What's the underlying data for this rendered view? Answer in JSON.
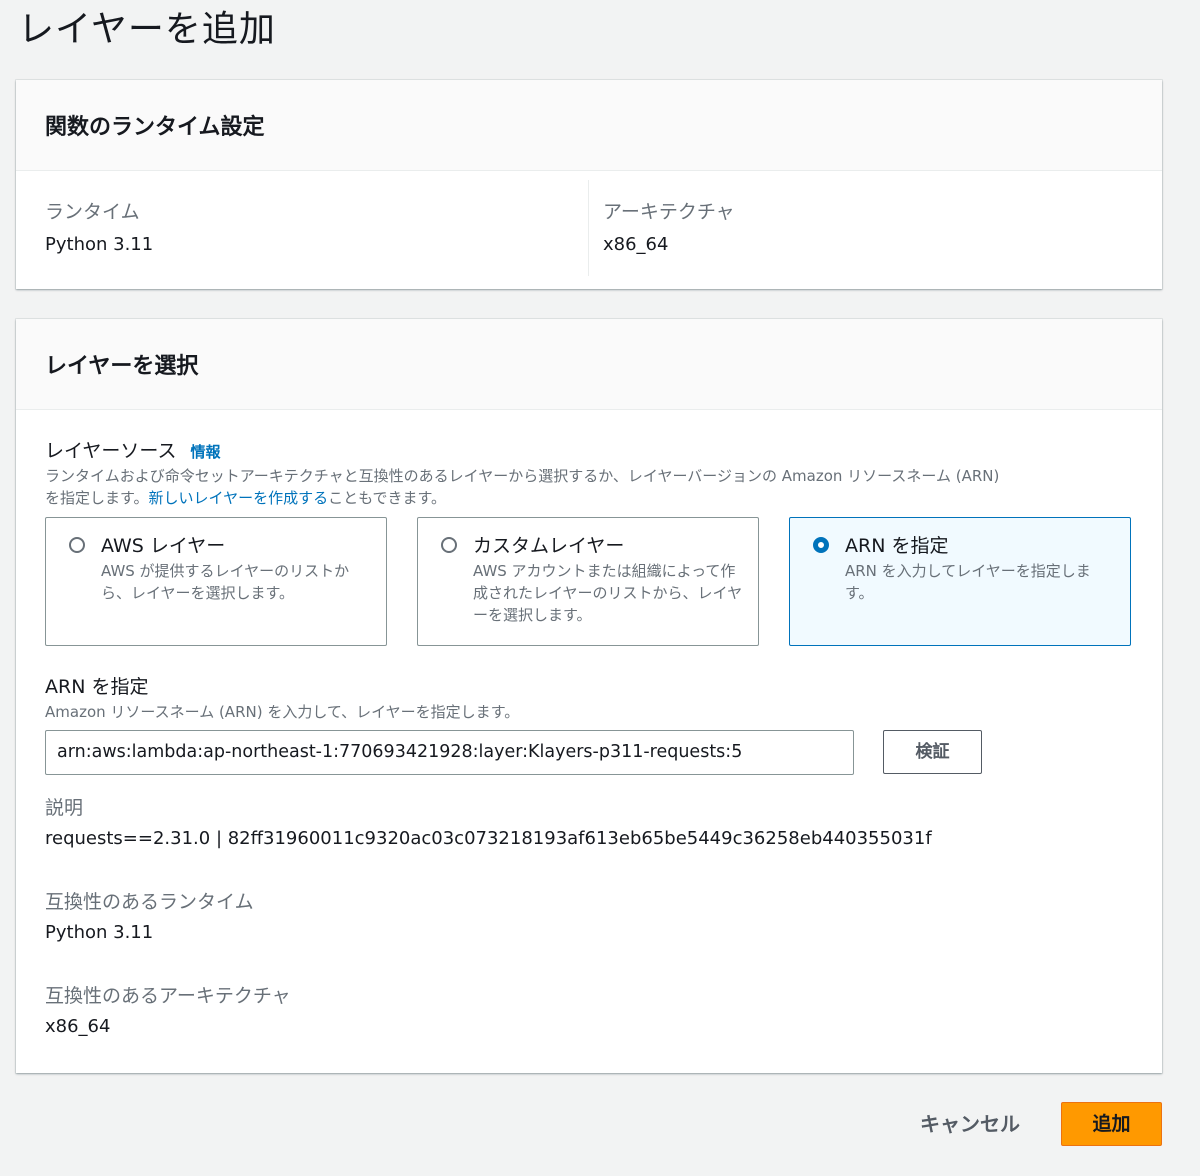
{
  "page": {
    "title": "レイヤーを追加"
  },
  "runtime_panel": {
    "heading": "関数のランタイム設定",
    "runtime_label": "ランタイム",
    "runtime_value": "Python 3.11",
    "arch_label": "アーキテクチャ",
    "arch_value": "x86_64"
  },
  "layer_panel": {
    "heading": "レイヤーを選択",
    "source_label": "レイヤーソース",
    "info_link": "情報",
    "source_desc_1": "ランタイムおよび命令セットアーキテクチャと互換性のあるレイヤーから選択するか、レイヤーバージョンの Amazon リソースネーム (ARN)",
    "source_desc_2_pre": "を指定します。",
    "source_desc_link": "新しいレイヤーを作成する",
    "source_desc_2_post": "こともできます。",
    "options": [
      {
        "title": "AWS レイヤー",
        "desc": "AWS が提供するレイヤーのリストから、レイヤーを選択します。",
        "selected": false
      },
      {
        "title": "カスタムレイヤー",
        "desc": "AWS アカウントまたは組織によって作成されたレイヤーのリストから、レイヤーを選択します。",
        "selected": false
      },
      {
        "title": "ARN を指定",
        "desc": "ARN を入力してレイヤーを指定します。",
        "selected": true
      }
    ],
    "arn_label": "ARN を指定",
    "arn_desc": "Amazon リソースネーム (ARN) を入力して、レイヤーを指定します。",
    "arn_value": "arn:aws:lambda:ap-northeast-1:770693421928:layer:Klayers-p311-requests:5",
    "verify_button": "検証",
    "description_label": "説明",
    "description_value": "requests==2.31.0 | 82ff31960011c9320ac03c073218193af613eb65be5449c36258eb440355031f",
    "compat_runtime_label": "互換性のあるランタイム",
    "compat_runtime_value": "Python 3.11",
    "compat_arch_label": "互換性のあるアーキテクチャ",
    "compat_arch_value": "x86_64"
  },
  "footer": {
    "cancel": "キャンセル",
    "add": "追加"
  },
  "colors": {
    "accent": "#0073bb",
    "primary_button": "#ff9900",
    "selected_tile_bg": "#f1faff"
  }
}
